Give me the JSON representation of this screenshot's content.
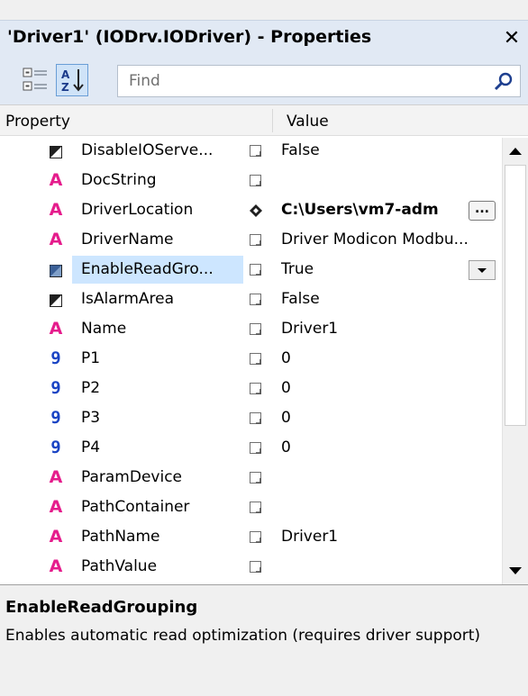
{
  "window": {
    "title": "'Driver1' (IODrv.IODriver) - Properties",
    "close_glyph": "✕"
  },
  "toolbar": {
    "find_placeholder": "Find",
    "find_value": ""
  },
  "grid": {
    "col_property": "Property",
    "col_value": "Value",
    "rows": [
      {
        "name": "DisableIOServe...",
        "value": "False",
        "type": "bool",
        "mark": "box",
        "bold": false,
        "button": ""
      },
      {
        "name": "DocString",
        "value": "",
        "type": "str",
        "mark": "box",
        "bold": false,
        "button": ""
      },
      {
        "name": "DriverLocation",
        "value": "C:\\Users\\vm7-adm",
        "type": "str",
        "mark": "diamond",
        "bold": true,
        "button": "ellipsis"
      },
      {
        "name": "DriverName",
        "value": "Driver Modicon Modbu...",
        "type": "str",
        "mark": "box",
        "bold": false,
        "button": ""
      },
      {
        "name": "EnableReadGro...",
        "value": "True",
        "type": "bool-sel",
        "mark": "box",
        "bold": false,
        "button": "dropdown",
        "selected": true
      },
      {
        "name": "IsAlarmArea",
        "value": "False",
        "type": "bool",
        "mark": "box",
        "bold": false,
        "button": ""
      },
      {
        "name": "Name",
        "value": "Driver1",
        "type": "str",
        "mark": "box",
        "bold": false,
        "button": ""
      },
      {
        "name": "P1",
        "value": "0",
        "type": "num",
        "mark": "box",
        "bold": false,
        "button": ""
      },
      {
        "name": "P2",
        "value": "0",
        "type": "num",
        "mark": "box",
        "bold": false,
        "button": ""
      },
      {
        "name": "P3",
        "value": "0",
        "type": "num",
        "mark": "box",
        "bold": false,
        "button": ""
      },
      {
        "name": "P4",
        "value": "0",
        "type": "num",
        "mark": "box",
        "bold": false,
        "button": ""
      },
      {
        "name": "ParamDevice",
        "value": "",
        "type": "str",
        "mark": "box",
        "bold": false,
        "button": ""
      },
      {
        "name": "PathContainer",
        "value": "",
        "type": "str",
        "mark": "box",
        "bold": false,
        "button": ""
      },
      {
        "name": "PathName",
        "value": "Driver1",
        "type": "str",
        "mark": "box",
        "bold": false,
        "button": ""
      },
      {
        "name": "PathValue",
        "value": "",
        "type": "str",
        "mark": "box",
        "bold": false,
        "button": ""
      }
    ],
    "ellipsis_label": "..."
  },
  "icons": {
    "string_glyph": "A",
    "number_glyph": "9"
  },
  "description": {
    "title": "EnableReadGrouping",
    "text": "Enables automatic read optimization (requires driver support)"
  },
  "colors": {
    "string_icon": "#e51c8c",
    "number_icon": "#1a44c4",
    "selection": "#cde6ff"
  }
}
